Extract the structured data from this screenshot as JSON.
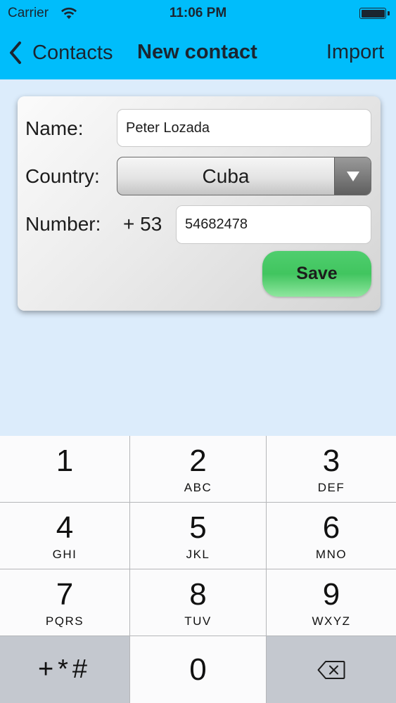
{
  "status_bar": {
    "carrier": "Carrier",
    "time": "11:06 PM",
    "wifi_icon": "wifi-icon",
    "battery_icon": "battery-icon"
  },
  "nav": {
    "back_label": "Contacts",
    "title": "New contact",
    "import_label": "Import",
    "back_icon": "chevron-left-icon"
  },
  "form": {
    "name_label": "Name:",
    "name_value": "Peter Lozada",
    "country_label": "Country:",
    "country_value": "Cuba",
    "number_label": "Number:",
    "number_prefix": "+ 53",
    "number_value": "54682478",
    "save_label": "Save"
  },
  "keypad": {
    "keys": [
      {
        "num": "1",
        "letters": ""
      },
      {
        "num": "2",
        "letters": "ABC"
      },
      {
        "num": "3",
        "letters": "DEF"
      },
      {
        "num": "4",
        "letters": "GHI"
      },
      {
        "num": "5",
        "letters": "JKL"
      },
      {
        "num": "6",
        "letters": "MNO"
      },
      {
        "num": "7",
        "letters": "PQRS"
      },
      {
        "num": "8",
        "letters": "TUV"
      },
      {
        "num": "9",
        "letters": "WXYZ"
      }
    ],
    "symbols_label": "+*#",
    "zero": "0",
    "backspace_icon": "backspace-icon"
  },
  "colors": {
    "header": "#00bdfb",
    "background": "#dcecfb",
    "save_green": "#41c55f"
  }
}
